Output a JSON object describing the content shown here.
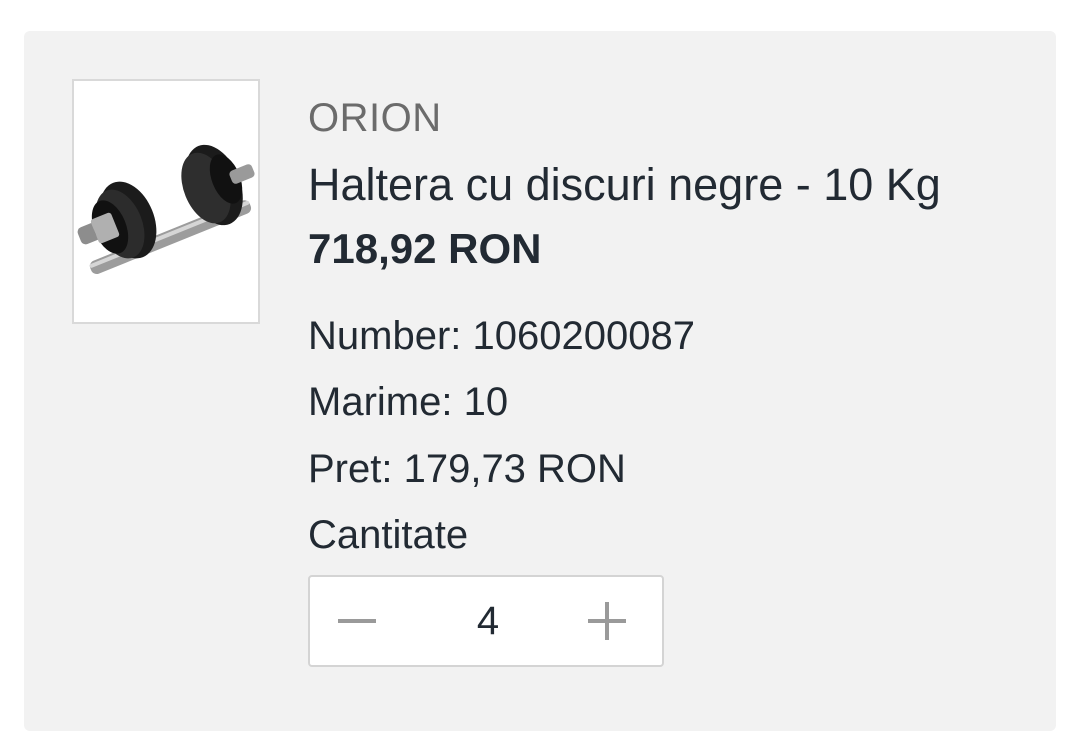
{
  "product": {
    "brand": "ORION",
    "title": "Haltera cu discuri negre - 10 Kg",
    "price": "718,92 RON",
    "image_icon": "dumbbell-icon",
    "specs": {
      "number": "Number: 1060200087",
      "size": "Marime: 10",
      "unit_price": "Pret: 179,73 RON"
    },
    "quantity_label": "Cantitate",
    "quantity": "4",
    "decrement_icon": "minus-icon",
    "increment_icon": "plus-icon"
  },
  "colors": {
    "card_background": "#f2f2f2",
    "text_primary": "#222a33",
    "text_muted": "#6b6b6b",
    "stepper_icon": "#9a9a9a"
  }
}
